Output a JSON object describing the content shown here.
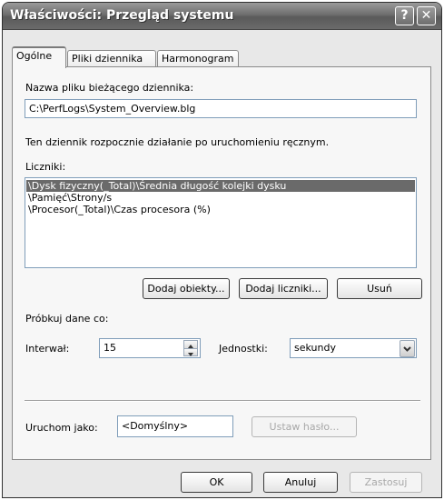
{
  "window": {
    "title": "Właściwości: Przegląd systemu",
    "help_label": "?",
    "close_label": "✕"
  },
  "tabs": [
    {
      "label": "Ogólne"
    },
    {
      "label": "Pliki dziennika"
    },
    {
      "label": "Harmonogram"
    }
  ],
  "general": {
    "log_file_label": "Nazwa pliku bieżącego dziennika:",
    "log_file_value": "C:\\PerfLogs\\System_Overview.blg",
    "info_text": "Ten dziennik rozpocznie działanie po uruchomieniu ręcznym.",
    "counters_label": "Liczniki:",
    "counters": [
      "\\Dysk fizyczny(_Total)\\Średnia długość kolejki dysku",
      "\\Pamięć\\Strony/s",
      "\\Procesor(_Total)\\Czas procesora (%)"
    ],
    "add_objects_label": "Dodaj obiekty...",
    "add_counters_label": "Dodaj liczniki...",
    "remove_label": "Usuń",
    "sample_label": "Próbkuj dane co:",
    "interval_label": "Interwał:",
    "interval_value": "15",
    "units_label": "Jednostki:",
    "units_value": "sekundy",
    "run_as_label": "Uruchom jako:",
    "run_as_value": "<Domyślny>",
    "set_password_label": "Ustaw hasło..."
  },
  "footer": {
    "ok_label": "OK",
    "cancel_label": "Anuluj",
    "apply_label": "Zastosuj"
  }
}
